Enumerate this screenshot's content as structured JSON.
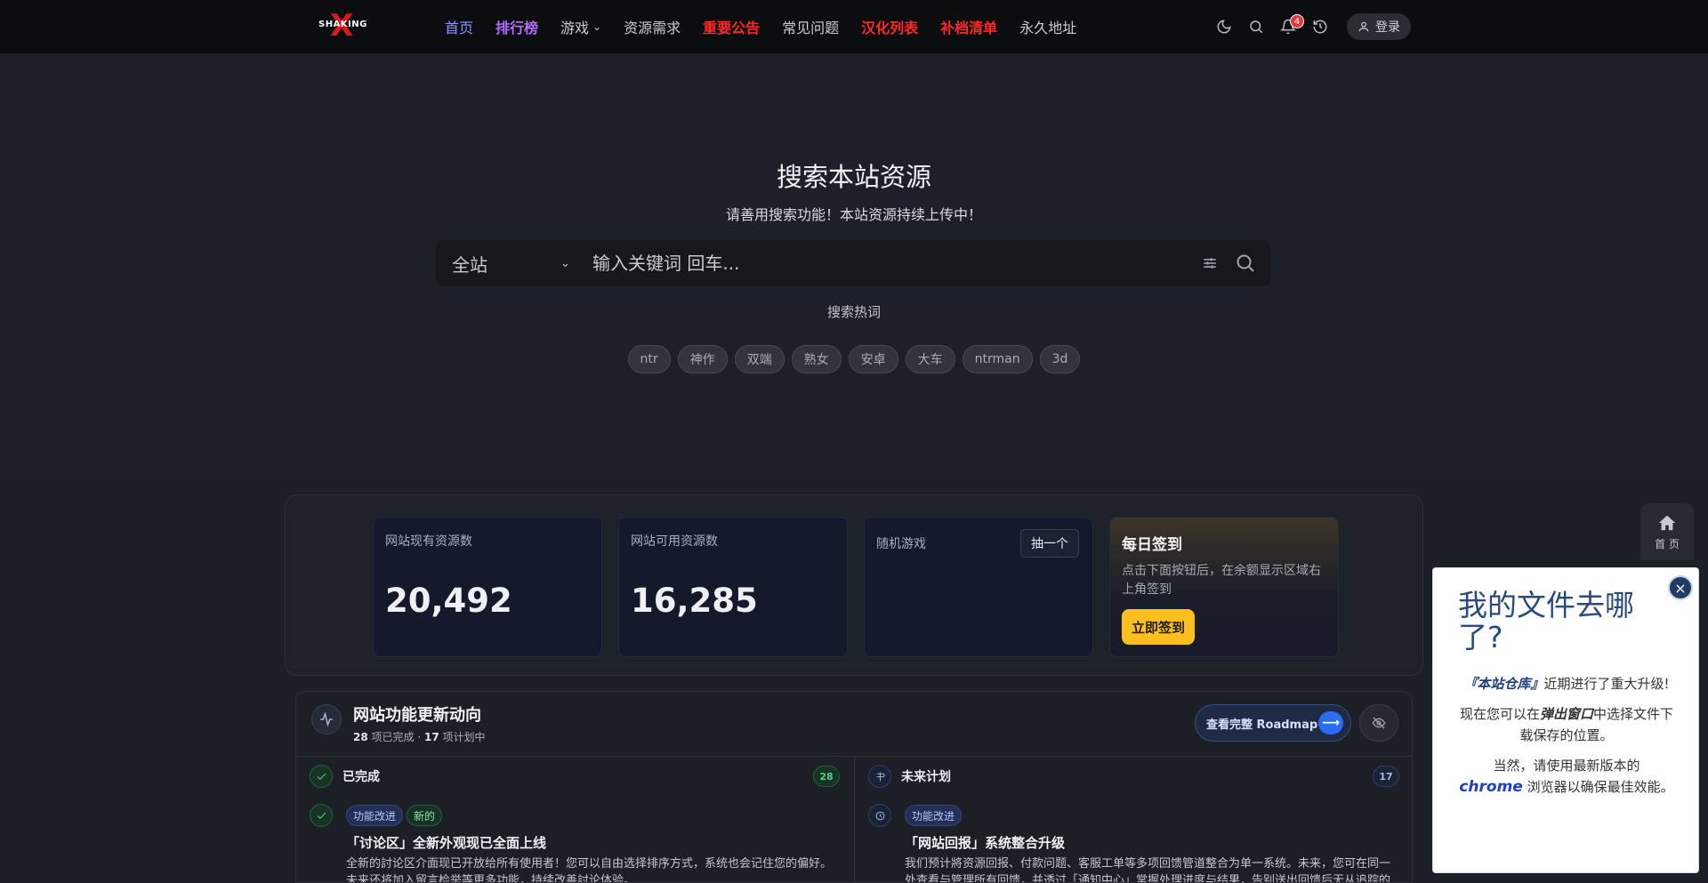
{
  "nav": {
    "logo_text": "SHAKING",
    "links": [
      {
        "label": "首页",
        "style": "blue"
      },
      {
        "label": "排行榜",
        "style": "purple"
      },
      {
        "label": "游戏",
        "style": "normal",
        "dropdown": true
      },
      {
        "label": "资源需求",
        "style": "normal"
      },
      {
        "label": "重要公告",
        "style": "red"
      },
      {
        "label": "常见问题",
        "style": "normal"
      },
      {
        "label": "汉化列表",
        "style": "red"
      },
      {
        "label": "补档清单",
        "style": "red"
      },
      {
        "label": "永久地址",
        "style": "normal"
      }
    ],
    "notification_count": "4",
    "login_label": "登录"
  },
  "hero": {
    "title": "搜索本站资源",
    "subtitle": "请善用搜索功能！本站资源持续上传中！",
    "scope": "全站",
    "placeholder": "输入关键词 回车...",
    "hot_title": "搜索热词",
    "hot_tags": [
      "ntr",
      "神作",
      "双端",
      "熟女",
      "安卓",
      "大车",
      "ntrman",
      "3d"
    ]
  },
  "stats": {
    "total_label": "网站现有资源数",
    "total_value": "20,492",
    "available_label": "网站可用资源数",
    "available_value": "16,285",
    "random_label": "随机游戏",
    "random_button": "抽一个",
    "checkin_title": "每日签到",
    "checkin_desc": "点击下面按钮后，在余额显示区域右上角签到",
    "checkin_button": "立即签到"
  },
  "roadmap": {
    "title": "网站功能更新动向",
    "done_count": "28",
    "done_text": "项已完成 · ",
    "planned_count": "17",
    "planned_text": "项计划中",
    "view_button": "查看完整 Roadmap",
    "completed": {
      "title": "已完成",
      "count": "28",
      "item": {
        "chips": [
          "功能改进",
          "新的"
        ],
        "title": "「讨论区」全新外观现已全面上线",
        "desc": "全新的討论区介面现已开放给所有使用者！您可以自由选择排序方式，系统也会记住您的偏好。未来还将加入留言检举等更多功能，持续改善討论体验。"
      }
    },
    "planned": {
      "title": "未来计划",
      "count": "17",
      "item": {
        "chips": [
          "功能改进"
        ],
        "title": "「网站回报」系统整合升级",
        "desc": "我们预计將资源回报、付款问题、客服工单等多项回馈管道整合为单一系统。未来，您可在同一处查看与管理所有回馈，并透过「通知中心」掌握处理进度与结果，告别送出回馈后无从追踪的困扰。"
      }
    }
  },
  "side": {
    "home_label": "首 页"
  },
  "popup": {
    "title": "我的文件去哪了?",
    "p1_em": "『本站仓库』",
    "p1_rest": "近期进行了重大升级!",
    "p2_pre": "现在您可以在",
    "p2_em": "弹出窗口",
    "p2_post": "中选择文件下载保存的位置。",
    "p3_pre": "当然，请使用最新版本的",
    "p3_em": "chrome",
    "p3_post": "浏览器以确保最佳效能。"
  }
}
